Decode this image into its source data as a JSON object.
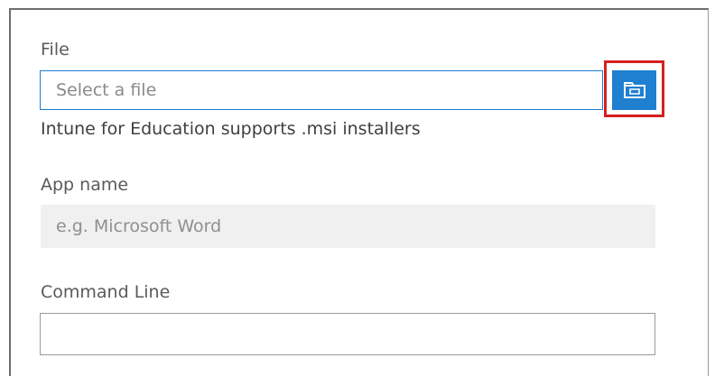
{
  "file": {
    "label": "File",
    "placeholder": "Select a file",
    "browse_icon": "folder-icon",
    "help_text": "Intune for Education supports .msi installers"
  },
  "app_name": {
    "label": "App name",
    "placeholder": "e.g. Microsoft Word"
  },
  "command_line": {
    "label": "Command Line",
    "value": ""
  },
  "colors": {
    "accent": "#1f7fd0",
    "highlight": "#d62020",
    "disabled_bg": "#f0f0f0"
  }
}
